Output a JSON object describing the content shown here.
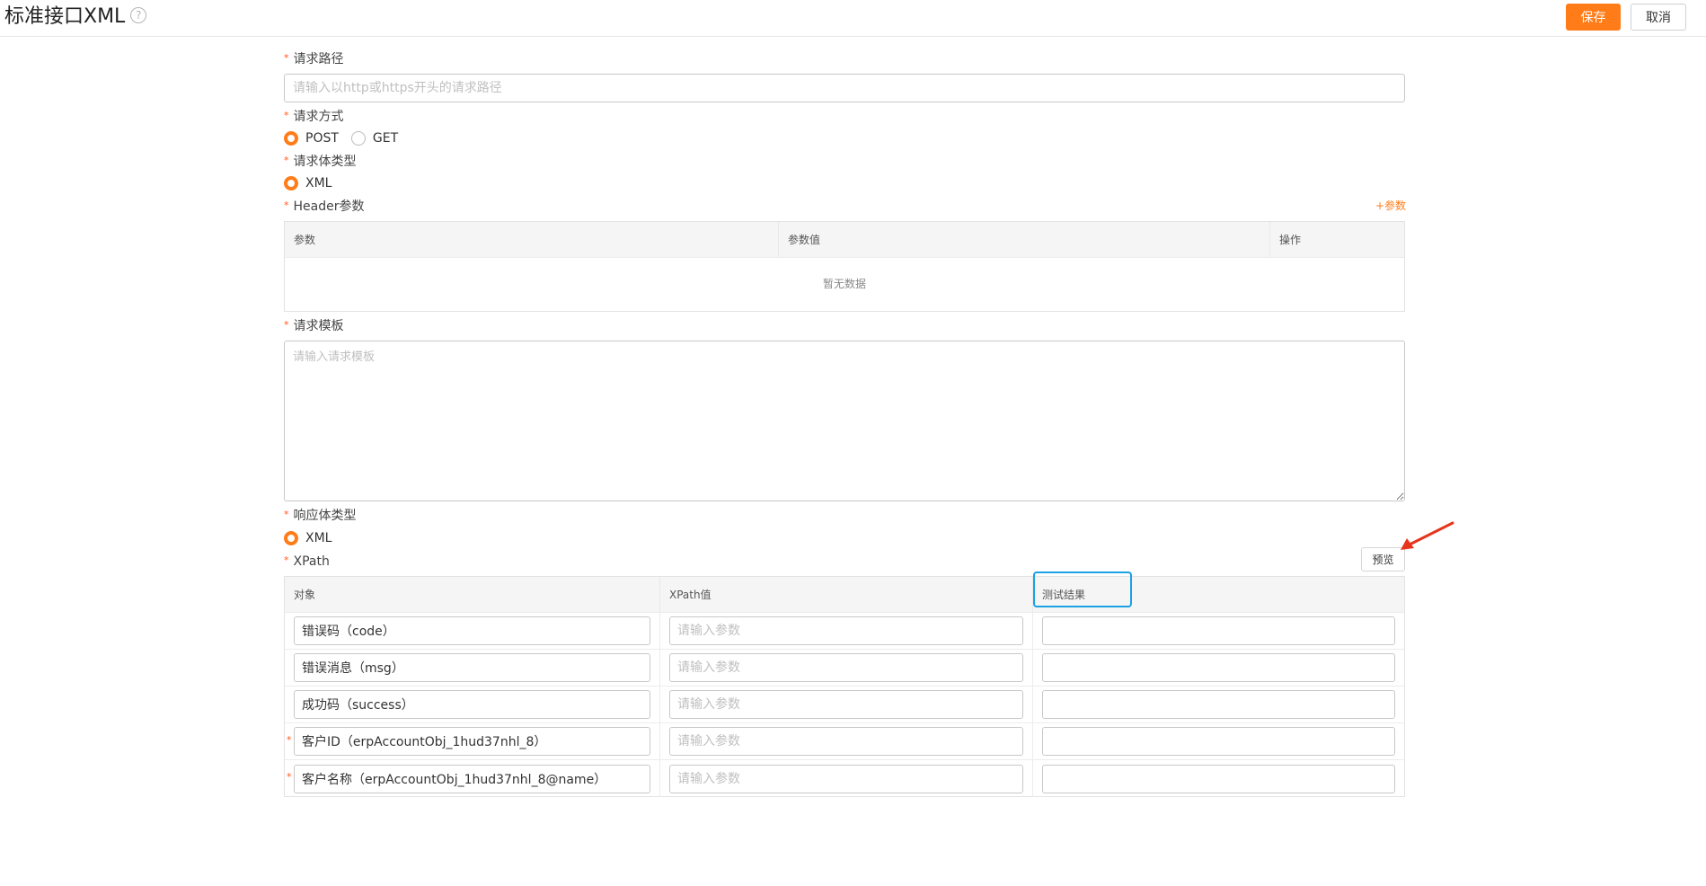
{
  "header": {
    "title": "标准接口XML",
    "help_icon": "question-circle-icon",
    "save_label": "保存",
    "cancel_label": "取消"
  },
  "colors": {
    "accent": "#ff7c19",
    "required": "#ff5722",
    "highlight": "#1aa1e6"
  },
  "form": {
    "request_path": {
      "label": "请求路径",
      "required": true,
      "value": "",
      "placeholder": "请输入以http或https开头的请求路径"
    },
    "request_method": {
      "label": "请求方式",
      "required": true,
      "options": [
        "POST",
        "GET"
      ],
      "selected": "POST"
    },
    "request_body_type": {
      "label": "请求体类型",
      "required": true,
      "options": [
        "XML"
      ],
      "selected": "XML"
    },
    "header_params": {
      "label": "Header参数",
      "required": true,
      "add_label": "+参数",
      "columns": [
        "参数",
        "参数值",
        "操作"
      ],
      "rows": [],
      "empty_text": "暂无数据"
    },
    "request_template": {
      "label": "请求模板",
      "required": true,
      "value": "",
      "placeholder": "请输入请求模板"
    },
    "response_body_type": {
      "label": "响应体类型",
      "required": true,
      "options": [
        "XML"
      ],
      "selected": "XML"
    },
    "xpath": {
      "label": "XPath",
      "required": true,
      "preview_label": "预览",
      "columns": [
        "对象",
        "XPath值",
        "测试结果"
      ],
      "rows": [
        {
          "object": "错误码（code）",
          "xpath": "",
          "xpath_placeholder": "请输入参数",
          "result": "",
          "required": false
        },
        {
          "object": "错误消息（msg）",
          "xpath": "",
          "xpath_placeholder": "请输入参数",
          "result": "",
          "required": false
        },
        {
          "object": "成功码（success）",
          "xpath": "",
          "xpath_placeholder": "请输入参数",
          "result": "",
          "required": false
        },
        {
          "object": "客户ID（erpAccountObj_1hud37nhl_8）",
          "xpath": "",
          "xpath_placeholder": "请输入参数",
          "result": "",
          "required": true
        },
        {
          "object": "客户名称（erpAccountObj_1hud37nhl_8@name）",
          "xpath": "",
          "xpath_placeholder": "请输入参数",
          "result": "",
          "required": true
        }
      ]
    }
  }
}
